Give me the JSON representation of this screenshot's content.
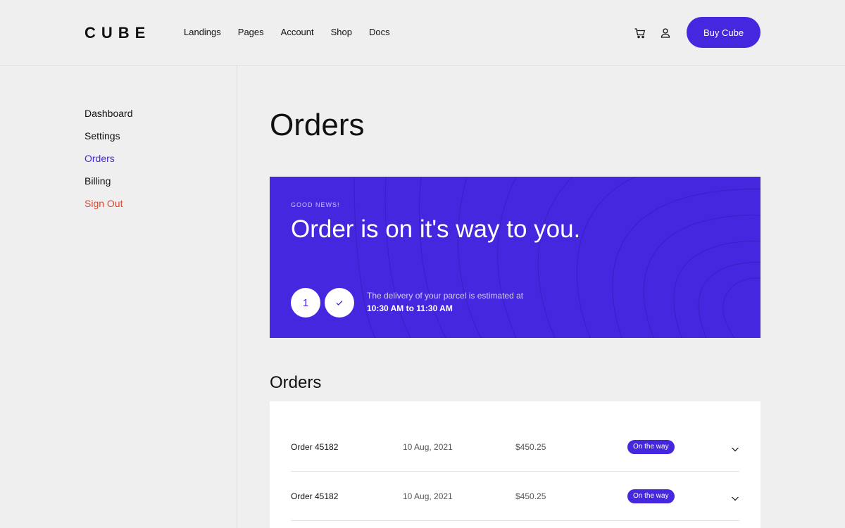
{
  "header": {
    "logo": "CUBE",
    "nav": [
      "Landings",
      "Pages",
      "Account",
      "Shop",
      "Docs"
    ],
    "cart_icon": "cart-icon",
    "user_icon": "user-icon",
    "buy_label": "Buy Cube"
  },
  "sidebar": {
    "items": [
      {
        "label": "Dashboard"
      },
      {
        "label": "Settings"
      },
      {
        "label": "Orders",
        "active": true
      },
      {
        "label": "Billing"
      },
      {
        "label": "Sign Out",
        "danger": true
      }
    ]
  },
  "main": {
    "title": "Orders",
    "banner": {
      "eyebrow": "GOOD NEWS!",
      "title": "Order is on it's way to you.",
      "step": "1",
      "check_icon": "check-icon",
      "delivery_label": "The delivery of your parcel is estimated at",
      "delivery_time": "10:30 AM to 11:30 AM"
    },
    "orders_title": "Orders",
    "orders": [
      {
        "name": "Order 45182",
        "date": "10 Aug, 2021",
        "amount": "$450.25",
        "status": "On the way"
      },
      {
        "name": "Order 45182",
        "date": "10 Aug, 2021",
        "amount": "$450.25",
        "status": "On the way"
      }
    ]
  },
  "colors": {
    "accent": "#4527e0",
    "danger": "#e0452d",
    "background": "#efefef"
  }
}
